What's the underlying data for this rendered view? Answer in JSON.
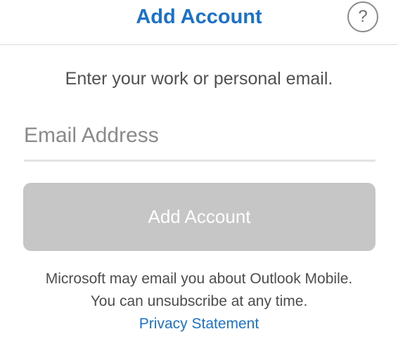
{
  "header": {
    "title": "Add Account",
    "help_icon_glyph": "?"
  },
  "form": {
    "instruction": "Enter your work or personal email.",
    "email_placeholder": "Email Address",
    "email_value": "",
    "submit_label": "Add Account"
  },
  "footer": {
    "line1": "Microsoft may email you about Outlook Mobile.",
    "line2": "You can unsubscribe at any time.",
    "privacy_link": "Privacy Statement"
  },
  "colors": {
    "accent": "#1a73c9",
    "button_disabled": "#c6c6c6",
    "divider": "#dcdcdc"
  }
}
